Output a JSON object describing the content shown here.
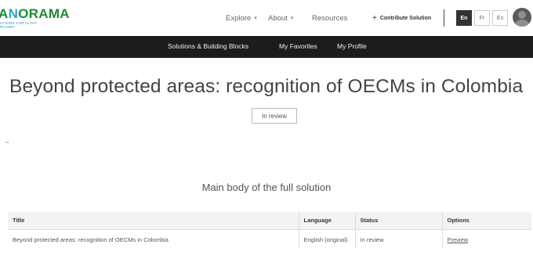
{
  "header": {
    "logo": {
      "word_prefix": "A",
      "word_accent": "N",
      "word_suffix": "ORAMA",
      "subtitle": "UTIONS FOR ALTHY PLANET"
    },
    "nav": {
      "explore": "Explore",
      "about": "About",
      "resources": "Resources"
    },
    "contribute_label": "Contribute Solution",
    "languages": [
      "En",
      "Fr",
      "Es"
    ],
    "active_language": "En"
  },
  "subnav": {
    "solutions": "Solutions & Building Blocks",
    "favorites": "My Favorites",
    "profile": "My Profile"
  },
  "page": {
    "title": "Beyond protected areas: recognition of OECMs in Colombia",
    "status": "In review",
    "small_mark": "\"",
    "section_heading": "Main body of the full solution"
  },
  "table": {
    "headers": [
      "Title",
      "Language",
      "Status",
      "Options"
    ],
    "rows": [
      {
        "title": "Beyond protected areas: recognition of OECMs in Colombia",
        "language": "English (original)",
        "status": "In review",
        "option": "Preview"
      }
    ]
  },
  "colors": {
    "logo_green": "#1f8a3a",
    "logo_blue": "#2aa7c9",
    "darkbar": "#1c1c1c"
  },
  "icons": [
    "caret-down-icon",
    "plus-icon",
    "user-avatar-icon"
  ]
}
